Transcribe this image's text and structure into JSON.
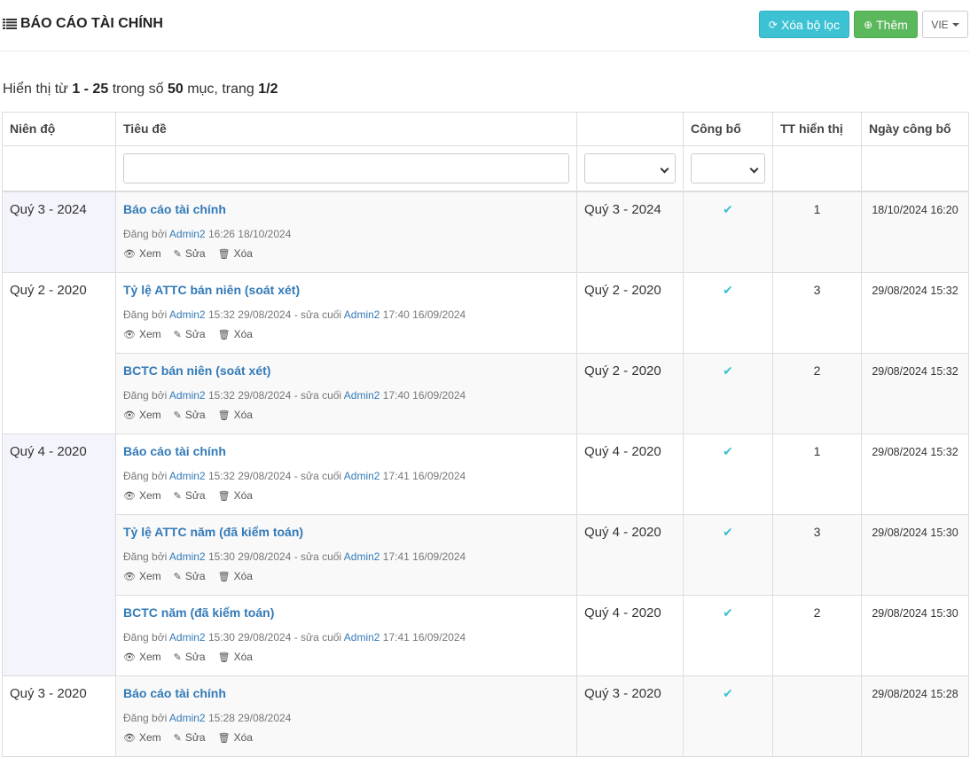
{
  "header": {
    "title": "BÁO CÁO TÀI CHÍNH",
    "clear_filter_label": "Xóa bộ lọc",
    "add_label": "Thêm",
    "language": "VIE"
  },
  "summary": {
    "prefix": "Hiển thị từ",
    "range": "1 - 25",
    "mid": "trong số",
    "total": "50",
    "suffix": "mục, trang",
    "page": "1/2"
  },
  "columns": [
    "Niên độ",
    "Tiêu đề",
    "",
    "Công bố",
    "TT hiển thị",
    "Ngày công bố"
  ],
  "labels": {
    "posted_by": "Đăng bởi",
    "edited_by": "- sửa cuối",
    "view": "Xem",
    "edit": "Sửa",
    "delete": "Xóa"
  },
  "rows": [
    {
      "group": "Quý 3 - 2024",
      "title": "Báo cáo tài chính",
      "author": "Admin2",
      "posted": "16:26 18/10/2024",
      "editor": "",
      "edited": "",
      "period": "Quý 3 - 2024",
      "published": "✔",
      "order": "1",
      "date": "18/10/2024 16:20"
    },
    {
      "group": "Quý 2 - 2020",
      "title": "Tỷ lệ ATTC bán niên (soát xét)",
      "author": "Admin2",
      "posted": "15:32 29/08/2024",
      "editor": "Admin2",
      "edited": "17:40 16/09/2024",
      "period": "Quý 2 - 2020",
      "published": "✔",
      "order": "3",
      "date": "29/08/2024 15:32"
    },
    {
      "group": "",
      "title": "BCTC bán niên (soát xét)",
      "author": "Admin2",
      "posted": "15:32 29/08/2024",
      "editor": "Admin2",
      "edited": "17:40 16/09/2024",
      "period": "Quý 2 - 2020",
      "published": "✔",
      "order": "2",
      "date": "29/08/2024 15:32"
    },
    {
      "group": "Quý 4 - 2020",
      "title": "Báo cáo tài chính",
      "author": "Admin2",
      "posted": "15:32 29/08/2024",
      "editor": "Admin2",
      "edited": "17:41 16/09/2024",
      "period": "Quý 4 - 2020",
      "published": "✔",
      "order": "1",
      "date": "29/08/2024 15:32"
    },
    {
      "group": "",
      "title": "Tỷ lệ ATTC năm (đã kiểm toán)",
      "author": "Admin2",
      "posted": "15:30 29/08/2024",
      "editor": "Admin2",
      "edited": "17:41 16/09/2024",
      "period": "Quý 4 - 2020",
      "published": "✔",
      "order": "3",
      "date": "29/08/2024 15:30"
    },
    {
      "group": "",
      "title": "BCTC năm (đã kiểm toán)",
      "author": "Admin2",
      "posted": "15:30 29/08/2024",
      "editor": "Admin2",
      "edited": "17:41 16/09/2024",
      "period": "Quý 4 - 2020",
      "published": "✔",
      "order": "2",
      "date": "29/08/2024 15:30"
    },
    {
      "group": "Quý 3 - 2020",
      "title": "Báo cáo tài chính",
      "author": "Admin2",
      "posted": "15:28 29/08/2024",
      "editor": "",
      "edited": "",
      "period": "Quý 3 - 2020",
      "published": "✔",
      "order": "",
      "date": "29/08/2024 15:28"
    }
  ],
  "row_groups": [
    {
      "label": "Quý 3 - 2024",
      "span": 1,
      "shaded": true
    },
    {
      "label": "Quý 2 - 2020",
      "span": 2,
      "shaded": false
    },
    {
      "label": "Quý 4 - 2020",
      "span": 3,
      "shaded": true
    },
    {
      "label": "Quý 3 - 2020",
      "span": 1,
      "shaded": false
    }
  ]
}
